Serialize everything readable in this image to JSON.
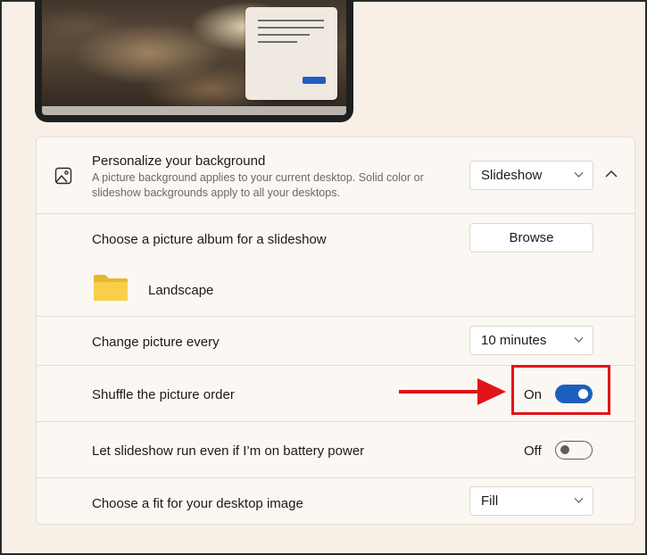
{
  "personalize": {
    "title": "Personalize your background",
    "description": "A picture background applies to your current desktop. Solid color or slideshow backgrounds apply to all your desktops.",
    "dropdown_value": "Slideshow",
    "icon": "image-icon",
    "expand_icon": "chevron-up-icon"
  },
  "album": {
    "label": "Choose a picture album for a slideshow",
    "button_label": "Browse",
    "folder_name": "Landscape",
    "folder_icon": "folder-icon"
  },
  "interval": {
    "label": "Change picture every",
    "dropdown_value": "10 minutes"
  },
  "shuffle": {
    "label": "Shuffle the picture order",
    "state_text": "On",
    "state": true
  },
  "battery": {
    "label": "Let slideshow run even if I’m on battery power",
    "state_text": "Off",
    "state": false
  },
  "fit": {
    "label": "Choose a fit for your desktop image",
    "dropdown_value": "Fill"
  },
  "colors": {
    "accent": "#1d5fbd",
    "annotation": "#e0141b",
    "background": "#f8f0e6"
  }
}
